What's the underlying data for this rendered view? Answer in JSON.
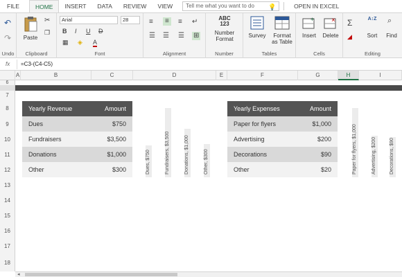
{
  "tabs": {
    "file": "FILE",
    "home": "HOME",
    "insert": "INSERT",
    "data": "DATA",
    "review": "REVIEW",
    "view": "VIEW",
    "tell_me": "Tell me what you want to do",
    "open_in_excel": "OPEN IN EXCEL"
  },
  "ribbon": {
    "undo": {
      "label": "Undo"
    },
    "clipboard": {
      "paste": "Paste",
      "label": "Clipboard"
    },
    "font": {
      "name": "Arial",
      "size": "28",
      "bold": "B",
      "italic": "I",
      "underline": "U",
      "strike": "D",
      "label": "Font"
    },
    "alignment": {
      "label": "Alignment"
    },
    "number": {
      "icon": "ABC\n123",
      "format": "Number",
      "format2": "Format",
      "label": "Number"
    },
    "tables": {
      "survey": "Survey",
      "format_as": "Format",
      "format_as2": "as Table",
      "label": "Tables"
    },
    "cells": {
      "insert": "Insert",
      "delete": "Delete",
      "label": "Cells"
    },
    "editing": {
      "sum": "Σ",
      "sort": "Sort",
      "find": "Find",
      "label": "Editing"
    }
  },
  "formula_bar": {
    "fx": "fx",
    "formula": "=C3-(C4-C5)"
  },
  "columns": [
    "A",
    "B",
    "C",
    "D",
    "E",
    "F",
    "G",
    "H",
    "I"
  ],
  "rows": [
    "6",
    "7",
    "8",
    "9",
    "10",
    "11",
    "12",
    "13",
    "14",
    "15",
    "16",
    "17",
    "18"
  ],
  "revenue": {
    "header": [
      "Yearly Revenue",
      "Amount"
    ],
    "rows": [
      [
        "Dues",
        "$750"
      ],
      [
        "Fundraisers",
        "$3,500"
      ],
      [
        "Donations",
        "$1,000"
      ],
      [
        "Other",
        "$300"
      ]
    ]
  },
  "expenses": {
    "header": [
      "Yearly Expenses",
      "Amount"
    ],
    "rows": [
      [
        "Paper for flyers",
        "$1,000"
      ],
      [
        "Advertising",
        "$200"
      ],
      [
        "Decorations",
        "$90"
      ],
      [
        "Other",
        "$20"
      ]
    ]
  },
  "revenue_bars": {
    "labels": [
      "Dues, $750",
      "Fundraisers, $3,500",
      "Donations, $1,000",
      "Other, $300"
    ],
    "values": [
      750,
      3500,
      1000,
      300
    ]
  },
  "expense_bars": {
    "labels": [
      "Paper for flyers, $1,000",
      "Advertising, $200",
      "Decorations, $90"
    ],
    "values": [
      1000,
      200,
      90
    ]
  }
}
